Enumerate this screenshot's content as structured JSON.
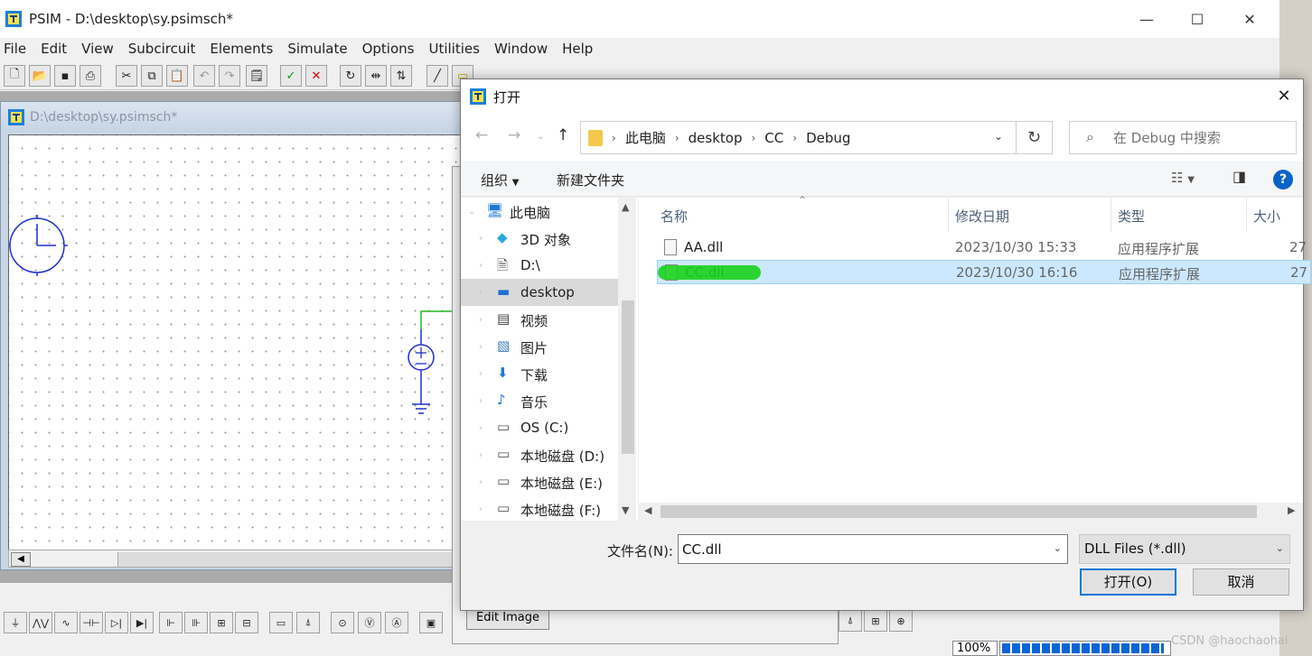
{
  "psim": {
    "title": "PSIM - D:\\desktop\\sy.psimsch*",
    "menu": [
      "File",
      "Edit",
      "View",
      "Subcircuit",
      "Elements",
      "Simulate",
      "Options",
      "Utilities",
      "Window",
      "Help"
    ],
    "doc_title": "D:\\desktop\\sy.psimsch*",
    "zoom": "100%",
    "progress": 0.96
  },
  "behind_dialog": {
    "edit_image_label": "Edit Image"
  },
  "dialog": {
    "title": "打开",
    "breadcrumb": [
      "此电脑",
      "desktop",
      "CC",
      "Debug"
    ],
    "search_placeholder": "在 Debug 中搜索",
    "organize_label": "组织",
    "new_folder_label": "新建文件夹",
    "help_label": "?",
    "nav_tree": [
      {
        "label": "此电脑",
        "icon": "computer-icon",
        "selected": false
      },
      {
        "label": "3D 对象",
        "icon": "cube-icon",
        "selected": false
      },
      {
        "label": "D:\\",
        "icon": "document-icon",
        "selected": false
      },
      {
        "label": "desktop",
        "icon": "desktop-icon",
        "selected": true
      },
      {
        "label": "视频",
        "icon": "video-icon",
        "selected": false
      },
      {
        "label": "图片",
        "icon": "picture-icon",
        "selected": false
      },
      {
        "label": "下载",
        "icon": "download-icon",
        "selected": false
      },
      {
        "label": "音乐",
        "icon": "music-icon",
        "selected": false
      },
      {
        "label": "OS (C:)",
        "icon": "drive-icon",
        "selected": false
      },
      {
        "label": "本地磁盘 (D:)",
        "icon": "drive-icon",
        "selected": false
      },
      {
        "label": "本地磁盘 (E:)",
        "icon": "drive-icon",
        "selected": false
      },
      {
        "label": "本地磁盘 (F:)",
        "icon": "drive-icon",
        "selected": false
      }
    ],
    "columns": [
      "名称",
      "修改日期",
      "类型",
      "大小"
    ],
    "files": [
      {
        "name": "AA.dll",
        "date": "2023/10/30 15:33",
        "type": "应用程序扩展",
        "size": "27",
        "selected": false
      },
      {
        "name": "CC.dll",
        "date": "2023/10/30 16:16",
        "type": "应用程序扩展",
        "size": "27",
        "selected": true
      }
    ],
    "filename_label": "文件名(N):",
    "filename_value": "CC.dll",
    "filetype_value": "DLL Files (*.dll)",
    "open_label": "打开(O)",
    "cancel_label": "取消"
  },
  "watermark": "CSDN @haochaohai",
  "colors": {
    "accent": "#0078d7",
    "selection": "#cce8ff",
    "highlight_marker": "#19d21c",
    "schematic": "#1f2fd0",
    "wire": "#22b822"
  }
}
